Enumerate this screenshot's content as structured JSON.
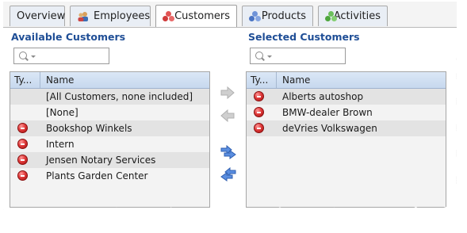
{
  "tabs": [
    {
      "label": "Overview",
      "icon": "none",
      "active": false
    },
    {
      "label": "Employees",
      "icon": "employees-icon",
      "active": false
    },
    {
      "label": "Customers",
      "icon": "customers-icon",
      "active": true
    },
    {
      "label": "Products",
      "icon": "products-icon",
      "active": false
    },
    {
      "label": "Activities",
      "icon": "activities-icon",
      "active": false
    }
  ],
  "available": {
    "title": "Available Customers",
    "columns": {
      "type": "Ty...",
      "name": "Name"
    },
    "rows": [
      {
        "name": "[All Customers, none included]",
        "icon": "none"
      },
      {
        "name": "[None]",
        "icon": "none"
      },
      {
        "name": "Bookshop Winkels",
        "icon": "red-customer-icon"
      },
      {
        "name": "Intern",
        "icon": "red-customer-icon"
      },
      {
        "name": "Jensen Notary Services",
        "icon": "red-customer-icon"
      },
      {
        "name": "Plants Garden Center",
        "icon": "red-customer-icon"
      }
    ]
  },
  "selected": {
    "title": "Selected Customers",
    "columns": {
      "type": "Ty...",
      "name": "Name"
    },
    "rows": [
      {
        "name": "Alberts autoshop",
        "icon": "red-customer-icon"
      },
      {
        "name": "BMW-dealer Brown",
        "icon": "red-customer-icon"
      },
      {
        "name": "deVries Volkswagen",
        "icon": "red-customer-icon"
      }
    ]
  },
  "colors": {
    "title": "#1f4e96",
    "header_bg": "#c7d8ee",
    "move_enabled": "#4a7fd4",
    "move_disabled": "#c8c8c8",
    "customer_red": "#e03b3b"
  }
}
